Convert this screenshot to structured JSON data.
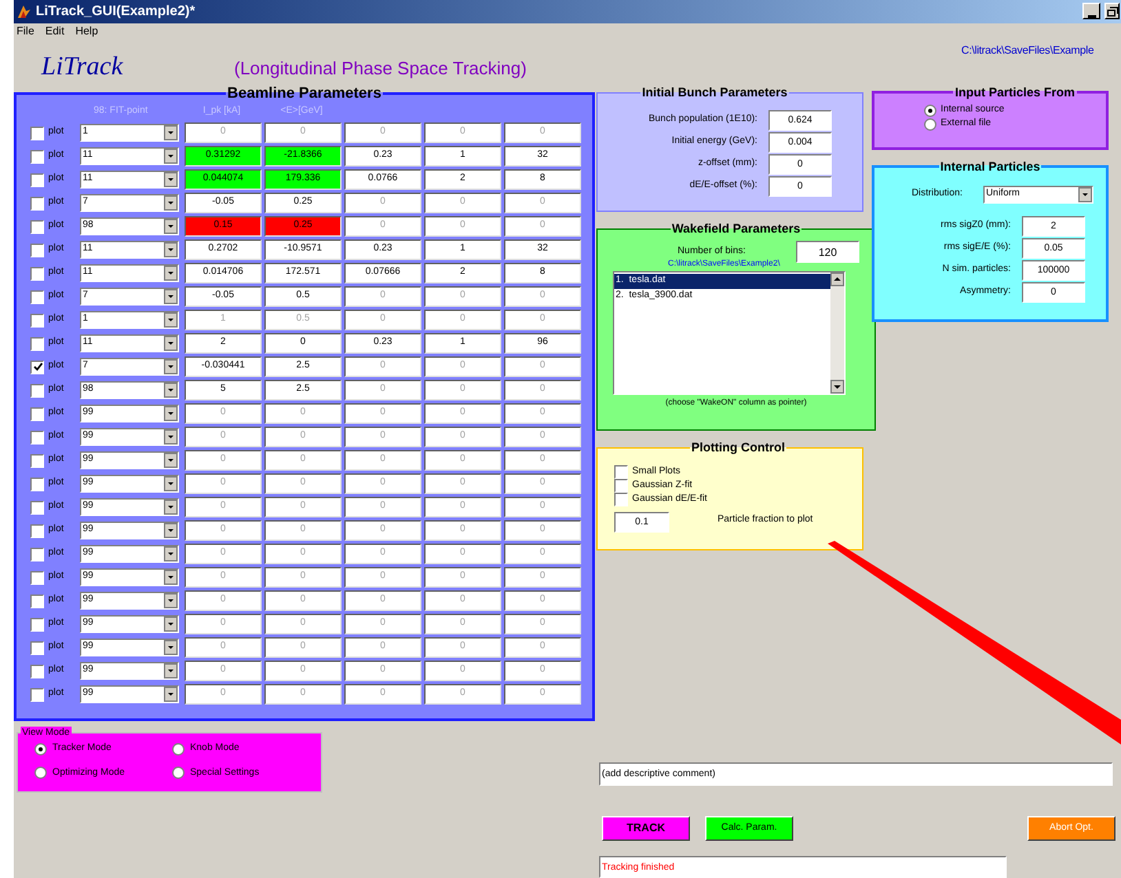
{
  "window": {
    "title": "LiTrack_GUI(Example2)*"
  },
  "menu": [
    "File",
    "Edit",
    "Help"
  ],
  "header": {
    "logo": "LiTrack",
    "subtitle": "(Longitudinal Phase Space Tracking)",
    "path": "C:\\litrack\\SaveFiles\\Example"
  },
  "beamline": {
    "title": "Beamline Parameters",
    "element_header": "98: FIT-point",
    "columns": [
      "I_pk [kA]",
      "<E>[GeV]"
    ],
    "rows": [
      {
        "plot": false,
        "label": "plot",
        "element": "1",
        "cells": [
          {
            "text": "0",
            "kind": "dim"
          },
          {
            "text": "0",
            "kind": "dim"
          },
          {
            "text": "0",
            "kind": "dim"
          },
          {
            "text": "0",
            "kind": "dim"
          },
          {
            "text": "0",
            "kind": "dim"
          }
        ]
      },
      {
        "plot": false,
        "label": "plot",
        "element": "11",
        "cells": [
          {
            "text": "0.31292",
            "kind": "fit"
          },
          {
            "text": "-21.8366",
            "kind": "fit"
          },
          {
            "text": "0.23",
            "kind": "normal"
          },
          {
            "text": "1",
            "kind": "normal"
          },
          {
            "text": "32",
            "kind": "normal"
          }
        ]
      },
      {
        "plot": false,
        "label": "plot",
        "element": "11",
        "cells": [
          {
            "text": "0.044074",
            "kind": "fit"
          },
          {
            "text": "179.336",
            "kind": "fit"
          },
          {
            "text": "0.0766",
            "kind": "normal"
          },
          {
            "text": "2",
            "kind": "normal"
          },
          {
            "text": "8",
            "kind": "normal"
          }
        ]
      },
      {
        "plot": false,
        "label": "plot",
        "element": "7",
        "cells": [
          {
            "text": "-0.05",
            "kind": "normal"
          },
          {
            "text": "0.25",
            "kind": "normal"
          },
          {
            "text": "0",
            "kind": "dim"
          },
          {
            "text": "0",
            "kind": "dim"
          },
          {
            "text": "0",
            "kind": "dim"
          }
        ]
      },
      {
        "plot": false,
        "label": "plot",
        "element": "98",
        "cells": [
          {
            "text": "0.15",
            "kind": "target"
          },
          {
            "text": "0.25",
            "kind": "target"
          },
          {
            "text": "0",
            "kind": "dim"
          },
          {
            "text": "0",
            "kind": "dim"
          },
          {
            "text": "0",
            "kind": "dim"
          }
        ]
      },
      {
        "plot": false,
        "label": "plot",
        "element": "11",
        "cells": [
          {
            "text": "0.2702",
            "kind": "normal"
          },
          {
            "text": "-10.9571",
            "kind": "normal"
          },
          {
            "text": "0.23",
            "kind": "normal"
          },
          {
            "text": "1",
            "kind": "normal"
          },
          {
            "text": "32",
            "kind": "normal"
          }
        ]
      },
      {
        "plot": false,
        "label": "plot",
        "element": "11",
        "cells": [
          {
            "text": "0.014706",
            "kind": "normal"
          },
          {
            "text": "172.571",
            "kind": "normal"
          },
          {
            "text": "0.07666",
            "kind": "normal"
          },
          {
            "text": "2",
            "kind": "normal"
          },
          {
            "text": "8",
            "kind": "normal"
          }
        ]
      },
      {
        "plot": false,
        "label": "plot",
        "element": "7",
        "cells": [
          {
            "text": "-0.05",
            "kind": "normal"
          },
          {
            "text": "0.5",
            "kind": "normal"
          },
          {
            "text": "0",
            "kind": "dim"
          },
          {
            "text": "0",
            "kind": "dim"
          },
          {
            "text": "0",
            "kind": "dim"
          }
        ]
      },
      {
        "plot": false,
        "label": "plot",
        "element": "1",
        "cells": [
          {
            "text": "1",
            "kind": "dim"
          },
          {
            "text": "0.5",
            "kind": "dim"
          },
          {
            "text": "0",
            "kind": "dim"
          },
          {
            "text": "0",
            "kind": "dim"
          },
          {
            "text": "0",
            "kind": "dim"
          }
        ]
      },
      {
        "plot": false,
        "label": "plot",
        "element": "11",
        "cells": [
          {
            "text": "2",
            "kind": "normal"
          },
          {
            "text": "0",
            "kind": "normal"
          },
          {
            "text": "0.23",
            "kind": "normal"
          },
          {
            "text": "1",
            "kind": "normal"
          },
          {
            "text": "96",
            "kind": "normal"
          }
        ]
      },
      {
        "plot": true,
        "label": "plot",
        "element": "7",
        "cells": [
          {
            "text": "-0.030441",
            "kind": "normal"
          },
          {
            "text": "2.5",
            "kind": "normal"
          },
          {
            "text": "0",
            "kind": "dim"
          },
          {
            "text": "0",
            "kind": "dim"
          },
          {
            "text": "0",
            "kind": "dim"
          }
        ]
      },
      {
        "plot": false,
        "label": "plot",
        "element": "98",
        "cells": [
          {
            "text": "5",
            "kind": "normal"
          },
          {
            "text": "2.5",
            "kind": "normal"
          },
          {
            "text": "0",
            "kind": "dim"
          },
          {
            "text": "0",
            "kind": "dim"
          },
          {
            "text": "0",
            "kind": "dim"
          }
        ]
      },
      {
        "plot": false,
        "label": "plot",
        "element": "99",
        "cells": [
          {
            "text": "0",
            "kind": "dim"
          },
          {
            "text": "0",
            "kind": "dim"
          },
          {
            "text": "0",
            "kind": "dim"
          },
          {
            "text": "0",
            "kind": "dim"
          },
          {
            "text": "0",
            "kind": "dim"
          }
        ]
      },
      {
        "plot": false,
        "label": "plot",
        "element": "99",
        "cells": [
          {
            "text": "0",
            "kind": "dim"
          },
          {
            "text": "0",
            "kind": "dim"
          },
          {
            "text": "0",
            "kind": "dim"
          },
          {
            "text": "0",
            "kind": "dim"
          },
          {
            "text": "0",
            "kind": "dim"
          }
        ]
      },
      {
        "plot": false,
        "label": "plot",
        "element": "99",
        "cells": [
          {
            "text": "0",
            "kind": "dim"
          },
          {
            "text": "0",
            "kind": "dim"
          },
          {
            "text": "0",
            "kind": "dim"
          },
          {
            "text": "0",
            "kind": "dim"
          },
          {
            "text": "0",
            "kind": "dim"
          }
        ]
      },
      {
        "plot": false,
        "label": "plot",
        "element": "99",
        "cells": [
          {
            "text": "0",
            "kind": "dim"
          },
          {
            "text": "0",
            "kind": "dim"
          },
          {
            "text": "0",
            "kind": "dim"
          },
          {
            "text": "0",
            "kind": "dim"
          },
          {
            "text": "0",
            "kind": "dim"
          }
        ]
      },
      {
        "plot": false,
        "label": "plot",
        "element": "99",
        "cells": [
          {
            "text": "0",
            "kind": "dim"
          },
          {
            "text": "0",
            "kind": "dim"
          },
          {
            "text": "0",
            "kind": "dim"
          },
          {
            "text": "0",
            "kind": "dim"
          },
          {
            "text": "0",
            "kind": "dim"
          }
        ]
      },
      {
        "plot": false,
        "label": "plot",
        "element": "99",
        "cells": [
          {
            "text": "0",
            "kind": "dim"
          },
          {
            "text": "0",
            "kind": "dim"
          },
          {
            "text": "0",
            "kind": "dim"
          },
          {
            "text": "0",
            "kind": "dim"
          },
          {
            "text": "0",
            "kind": "dim"
          }
        ]
      },
      {
        "plot": false,
        "label": "plot",
        "element": "99",
        "cells": [
          {
            "text": "0",
            "kind": "dim"
          },
          {
            "text": "0",
            "kind": "dim"
          },
          {
            "text": "0",
            "kind": "dim"
          },
          {
            "text": "0",
            "kind": "dim"
          },
          {
            "text": "0",
            "kind": "dim"
          }
        ]
      },
      {
        "plot": false,
        "label": "plot",
        "element": "99",
        "cells": [
          {
            "text": "0",
            "kind": "dim"
          },
          {
            "text": "0",
            "kind": "dim"
          },
          {
            "text": "0",
            "kind": "dim"
          },
          {
            "text": "0",
            "kind": "dim"
          },
          {
            "text": "0",
            "kind": "dim"
          }
        ]
      },
      {
        "plot": false,
        "label": "plot",
        "element": "99",
        "cells": [
          {
            "text": "0",
            "kind": "dim"
          },
          {
            "text": "0",
            "kind": "dim"
          },
          {
            "text": "0",
            "kind": "dim"
          },
          {
            "text": "0",
            "kind": "dim"
          },
          {
            "text": "0",
            "kind": "dim"
          }
        ]
      },
      {
        "plot": false,
        "label": "plot",
        "element": "99",
        "cells": [
          {
            "text": "0",
            "kind": "dim"
          },
          {
            "text": "0",
            "kind": "dim"
          },
          {
            "text": "0",
            "kind": "dim"
          },
          {
            "text": "0",
            "kind": "dim"
          },
          {
            "text": "0",
            "kind": "dim"
          }
        ]
      },
      {
        "plot": false,
        "label": "plot",
        "element": "99",
        "cells": [
          {
            "text": "0",
            "kind": "dim"
          },
          {
            "text": "0",
            "kind": "dim"
          },
          {
            "text": "0",
            "kind": "dim"
          },
          {
            "text": "0",
            "kind": "dim"
          },
          {
            "text": "0",
            "kind": "dim"
          }
        ]
      },
      {
        "plot": false,
        "label": "plot",
        "element": "99",
        "cells": [
          {
            "text": "0",
            "kind": "dim"
          },
          {
            "text": "0",
            "kind": "dim"
          },
          {
            "text": "0",
            "kind": "dim"
          },
          {
            "text": "0",
            "kind": "dim"
          },
          {
            "text": "0",
            "kind": "dim"
          }
        ]
      },
      {
        "plot": false,
        "label": "plot",
        "element": "99",
        "cells": [
          {
            "text": "0",
            "kind": "dim"
          },
          {
            "text": "0",
            "kind": "dim"
          },
          {
            "text": "0",
            "kind": "dim"
          },
          {
            "text": "0",
            "kind": "dim"
          },
          {
            "text": "0",
            "kind": "dim"
          }
        ]
      }
    ]
  },
  "view_mode": {
    "title": "View Mode",
    "options": [
      {
        "label": "Tracker Mode",
        "selected": true
      },
      {
        "label": "Knob Mode",
        "selected": false
      },
      {
        "label": "Optimizing Mode",
        "selected": false
      },
      {
        "label": "Special Settings",
        "selected": false
      }
    ]
  },
  "initial_bunch": {
    "title": "Initial Bunch Parameters",
    "fields": [
      {
        "label": "Bunch population (1E10):",
        "value": "0.624"
      },
      {
        "label": "Initial energy (GeV):",
        "value": "0.004"
      },
      {
        "label": "z-offset (mm):",
        "value": "0"
      },
      {
        "label": "dE/E-offset (%):",
        "value": "0"
      }
    ]
  },
  "wakefield": {
    "title": "Wakefield Parameters",
    "bins_label": "Number of bins:",
    "bins": "120",
    "path": "C:\\litrack\\SaveFiles\\Example2\\",
    "files": [
      {
        "text": "1.  tesla.dat",
        "selected": true
      },
      {
        "text": "2.  tesla_3900.dat",
        "selected": false
      }
    ],
    "note": "(choose \"WakeON\" column as pointer)"
  },
  "plotting": {
    "title": "Plotting Control",
    "options": [
      {
        "label": "Small Plots",
        "checked": false
      },
      {
        "label": "Gaussian Z-fit",
        "checked": false
      },
      {
        "label": "Gaussian dE/E-fit",
        "checked": false
      }
    ],
    "fraction": "0.1",
    "fraction_label": "Particle fraction to plot"
  },
  "input_particles": {
    "title": "Input Particles From",
    "options": [
      {
        "label": "Internal source",
        "selected": true
      },
      {
        "label": "External file",
        "selected": false
      }
    ]
  },
  "internal_particles": {
    "title": "Internal Particles",
    "distribution_label": "Distribution:",
    "distribution": "Uniform",
    "fields": [
      {
        "label": "rms sigZ0 (mm):",
        "value": "2"
      },
      {
        "label": "rms sigE/E (%):",
        "value": "0.05"
      },
      {
        "label": "N sim. particles:",
        "value": "100000"
      },
      {
        "label": "Asymmetry:",
        "value": "0"
      }
    ]
  },
  "comment": {
    "value": "(add descriptive comment)"
  },
  "buttons": [
    {
      "label": "TRACK",
      "kind": "track"
    },
    {
      "label": "Calc. Param.",
      "kind": "calc"
    },
    {
      "label": "Abort Opt.",
      "kind": "abort"
    }
  ],
  "status": "Tracking finished"
}
